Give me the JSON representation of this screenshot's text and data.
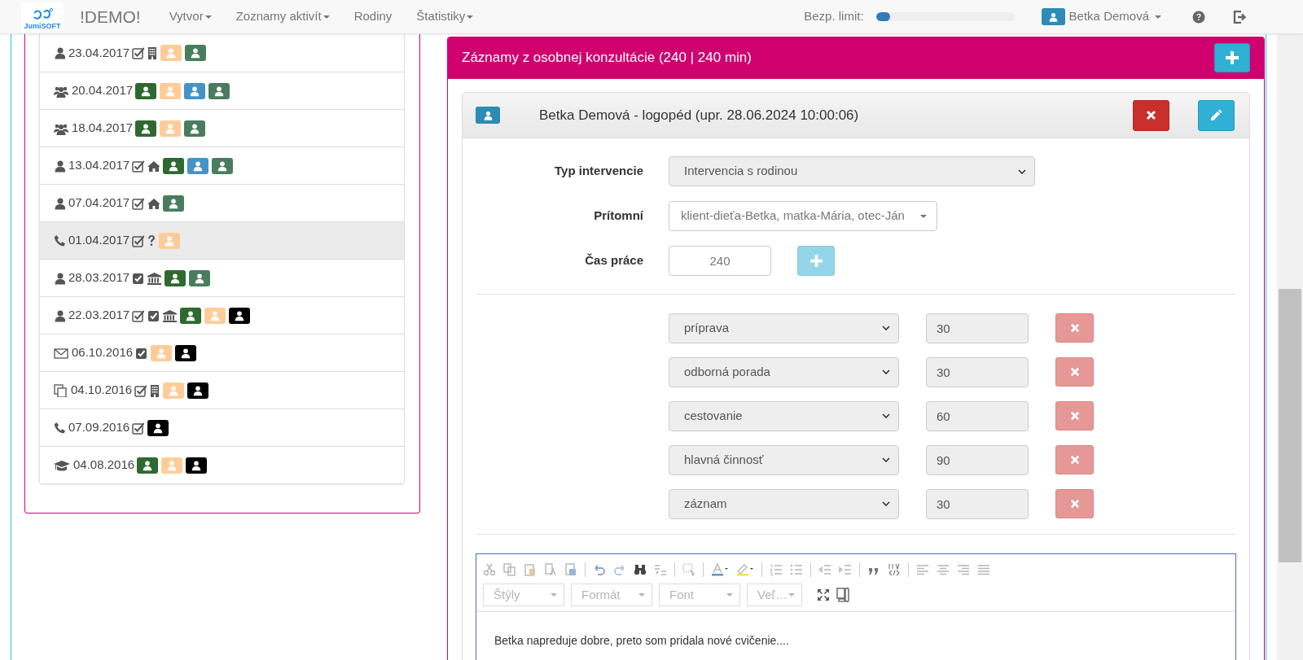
{
  "navbar": {
    "logo_text": "JumiSOFT",
    "brand": "!DEMO!",
    "menu": [
      {
        "label": "Vytvor",
        "dropdown": true
      },
      {
        "label": "Zoznamy aktivít",
        "dropdown": true
      },
      {
        "label": "Rodiny",
        "dropdown": false
      },
      {
        "label": "Štatistiky",
        "dropdown": true
      }
    ],
    "limit_label": "Bezp. limit:",
    "limit": {
      "level": 0.1
    },
    "user": "Betka Demová"
  },
  "activity_list": [
    {
      "kind": "person",
      "date": "23.04.2017",
      "selected": false,
      "markers": [
        {
          "kind": "check"
        },
        {
          "kind": "building"
        }
      ],
      "badges": [
        {
          "color": "#ffcc99"
        },
        {
          "color": "#4a7c5e"
        }
      ]
    },
    {
      "kind": "group",
      "date": "20.04.2017",
      "selected": false,
      "badges": [
        {
          "color": "#2e6930"
        },
        {
          "color": "#ffcc99"
        },
        {
          "color": "#4393c8"
        },
        {
          "color": "#4a7c5e"
        }
      ]
    },
    {
      "kind": "group",
      "date": "18.04.2017",
      "selected": false,
      "badges": [
        {
          "color": "#2e6930"
        },
        {
          "color": "#ffcc99"
        },
        {
          "color": "#4a7c5e"
        }
      ]
    },
    {
      "kind": "person",
      "date": "13.04.2017",
      "selected": false,
      "markers": [
        {
          "kind": "check"
        },
        {
          "kind": "home"
        }
      ],
      "badges": [
        {
          "color": "#2e6930"
        },
        {
          "color": "#4393c8"
        },
        {
          "color": "#4a7c5e"
        }
      ]
    },
    {
      "kind": "person",
      "date": "07.04.2017",
      "selected": false,
      "markers": [
        {
          "kind": "check"
        },
        {
          "kind": "home"
        }
      ],
      "badges": [
        {
          "color": "#4a7c5e"
        }
      ]
    },
    {
      "kind": "phone",
      "date": "01.04.2017",
      "selected": true,
      "markers": [
        {
          "kind": "check"
        },
        {
          "kind": "question"
        }
      ],
      "badges": [
        {
          "color": "#ffcc99"
        }
      ]
    },
    {
      "kind": "person",
      "date": "28.03.2017",
      "selected": false,
      "markers": [
        {
          "kind": "check-solid"
        },
        {
          "kind": "bank"
        }
      ],
      "badges": [
        {
          "color": "#2e6930"
        },
        {
          "color": "#4a7c5e"
        }
      ]
    },
    {
      "kind": "person",
      "date": "22.03.2017",
      "selected": false,
      "markers": [
        {
          "kind": "check"
        },
        {
          "kind": "check-solid"
        },
        {
          "kind": "bank"
        }
      ],
      "badges": [
        {
          "color": "#2e6930"
        },
        {
          "color": "#ffcc99"
        },
        {
          "color": "#000000"
        }
      ]
    },
    {
      "kind": "mail",
      "date": "06.10.2016",
      "selected": false,
      "markers": [
        {
          "kind": "check-solid"
        }
      ],
      "badges": [
        {
          "color": "#ffcc99"
        },
        {
          "color": "#000000"
        }
      ]
    },
    {
      "kind": "copy",
      "date": "04.10.2016",
      "selected": false,
      "markers": [
        {
          "kind": "check"
        },
        {
          "kind": "building"
        }
      ],
      "badges": [
        {
          "color": "#ffcc99"
        },
        {
          "color": "#000000"
        }
      ]
    },
    {
      "kind": "phone",
      "date": "07.09.2016",
      "selected": false,
      "markers": [
        {
          "kind": "check"
        }
      ],
      "badges": [
        {
          "color": "#000000"
        }
      ]
    },
    {
      "kind": "education",
      "date": "04.08.2016",
      "selected": false,
      "badges": [
        {
          "color": "#2e6930"
        },
        {
          "color": "#ffcc99"
        },
        {
          "color": "#000000"
        }
      ]
    }
  ],
  "records": {
    "title": "Záznamy z osobnej konzultácie (240 | 240 min)",
    "entry": {
      "badge": {
        "color": "#2e8bb5"
      },
      "title": "Betka Demová - logopéd (upr. 28.06.2024 10:00:06)",
      "fields": [
        {
          "kind": "select",
          "label": "Typ intervencie",
          "value": "Intervencia s rodinou"
        },
        {
          "kind": "dropdown",
          "label": "Prítomní",
          "value": "klient-dieťa-Betka, matka-Mária, otec-Ján"
        },
        {
          "kind": "number",
          "label": "Čas práce",
          "value": "240"
        }
      ],
      "activities": [
        {
          "type": "príprava",
          "minutes": "30"
        },
        {
          "type": "odborná porada",
          "minutes": "30"
        },
        {
          "type": "cestovanie",
          "minutes": "60"
        },
        {
          "type": "hlavná činnosť",
          "minutes": "90"
        },
        {
          "type": "záznam",
          "minutes": "30"
        }
      ],
      "editor": {
        "combos": [
          "Štýly",
          "Formát",
          "Font",
          "Veľ…"
        ],
        "text": "Betka napreduje dobre, preto som pridala nové cvičenie...."
      }
    }
  }
}
